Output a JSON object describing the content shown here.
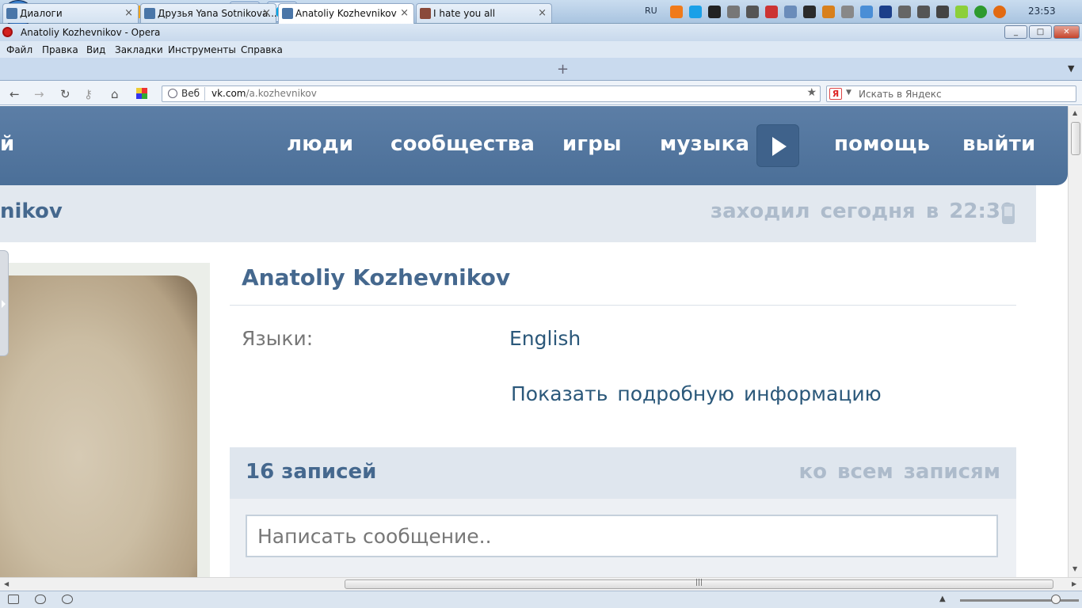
{
  "taskbar": {
    "language": "RU",
    "clock": "23:53",
    "pinned": [
      {
        "icon": "windows-start-icon"
      },
      {
        "icon": "app-round-icon",
        "color": "#d0d0d0"
      },
      {
        "icon": "photos-icon",
        "color": "#e08a22"
      },
      {
        "icon": "media-player-icon",
        "color": "#f2a51a"
      },
      {
        "icon": "explorer-folder-icon",
        "color": "#e8c256"
      },
      {
        "icon": "chrome-icon",
        "color": "#3ba14b"
      },
      {
        "icon": "opera-icon",
        "color": "#d4211e"
      },
      {
        "icon": "skype-icon",
        "color": "#00a8e8"
      }
    ]
  },
  "window": {
    "title": "Anatoliy Kozhevnikov - Opera",
    "min": "_",
    "max": "□",
    "close": "✕"
  },
  "menu": [
    "Файл",
    "Правка",
    "Вид",
    "Закладки",
    "Инструменты",
    "Справка"
  ],
  "tabs": [
    {
      "label": "Диалоги",
      "favicon_color": "#4a76a8",
      "active": false
    },
    {
      "label": "Друзья Yana Sotnikova...",
      "favicon_color": "#4a76a8",
      "active": false
    },
    {
      "label": "Anatoliy Kozhevnikov",
      "favicon_color": "#4a76a8",
      "active": true
    },
    {
      "label": "I hate you all",
      "favicon_color": "#8a4a3a",
      "active": false
    }
  ],
  "addressbar": {
    "web_label": "Веб",
    "url_host": "vk.com",
    "url_path": "/a.kozhevnikov",
    "search_placeholder": "Искать в Яндекс",
    "search_engine": "Я"
  },
  "vk": {
    "nav_cut": "й",
    "nav": {
      "people": "люди",
      "communities": "сообщества",
      "games": "игры",
      "music": "музыка",
      "help": "помощь",
      "logout": "выйти"
    },
    "header_name_cut": "nikov",
    "last_seen": "заходил сегодня в 22:39",
    "profile_name": "Anatoliy Kozhevnikov",
    "languages_label": "Языки:",
    "languages_value": "English",
    "show_more": "Показать подробную информацию",
    "wall_count": "16 записей",
    "wall_all": "ко всем записям",
    "post_placeholder": "Написать сообщение.."
  },
  "colors": {
    "vk_header": "#4b6f98",
    "vk_link": "#2b587a",
    "vk_name": "#45688e",
    "muted": "#adbbcb"
  }
}
